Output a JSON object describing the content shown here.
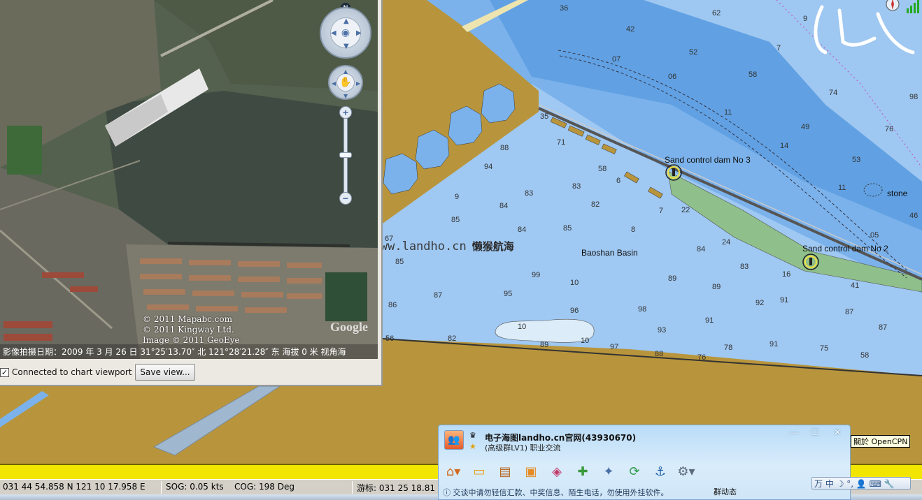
{
  "ge_panel": {
    "credits": [
      "© 2011 Mapabc.com",
      "© 2011 Kingway Ltd.",
      "Image © 2011 GeoEye"
    ],
    "google_logo": "Google",
    "info_line": "影像拍摄日期：2009 年 3 月 26 日 31°25′13.70″ 北    121°28′21.28″ 东    海拔    0 米 视角海",
    "north_label": "N",
    "connected_label": "Connected to chart viewport",
    "save_view_label": "Save view..."
  },
  "watermark": {
    "url": "http://www.landho.cn",
    "brand": "懒猴航海"
  },
  "chart": {
    "labels": {
      "dam3": "Sand control dam No 3",
      "dam2": "Sand control dam No 2",
      "basin": "Baoshan Basin",
      "stone": "stone"
    },
    "colors": {
      "land": "#b8953c",
      "deep_water": "#7bb2eb",
      "shallow_water": "#9fc8f2",
      "drying": "#8fbf8a",
      "channel": "#5c9de0"
    }
  },
  "qq": {
    "title": "电子海图landho.cn官网(43930670)",
    "subtitle": "(高级群LV1) 职业交流",
    "notice": "交谈中请勿轻信汇款、中奖信息、陌生电话，勿使用外挂软件。",
    "group_status": "群动态",
    "tools": [
      "home-icon",
      "folder-icon",
      "notes-icon",
      "app-icon",
      "shop-icon",
      "add-icon",
      "satellite-icon",
      "sync-icon",
      "ship-icon",
      "settings-icon"
    ]
  },
  "status": {
    "position": "031 44 54.858 N   121 10 17.958 E",
    "sog": "SOG:  0.05 kts",
    "cog": "COG:   198 Deg",
    "cursor": "游标: 031 25 18.81"
  },
  "opencpn_tooltip": "關於 OpenCPN",
  "ime": "万 中 ☽ °, 👤 ⌨ 🔧"
}
